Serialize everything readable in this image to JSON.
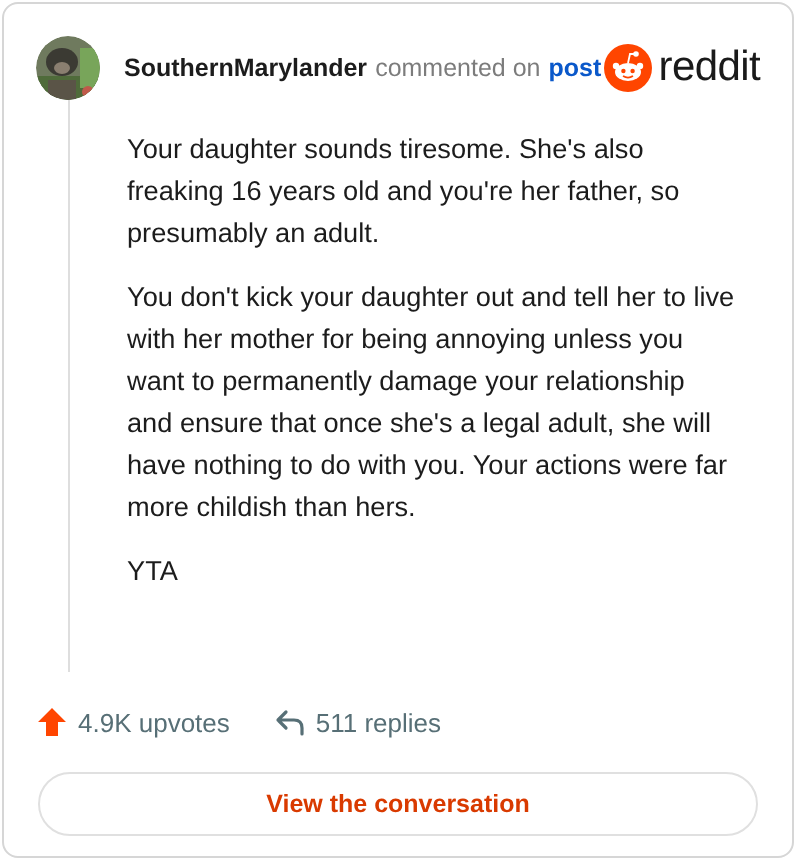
{
  "comment": {
    "author": "SouthernMarylander",
    "action": "commented on",
    "link": "post",
    "brand": "reddit",
    "paragraphs": [
      "Your daughter sounds tiresome. She's also freaking 16 years old and you're her father, so presumably an adult.",
      "You don't kick your daughter out and tell her to live with her mother for being annoying unless you want to permanently damage your relationship and ensure that once she's a legal adult, she will have nothing to do with you. Your actions were far more childish than hers.",
      "YTA"
    ],
    "upvotes": "4.9K upvotes",
    "replies": "511 replies"
  },
  "button": "View the conversation"
}
